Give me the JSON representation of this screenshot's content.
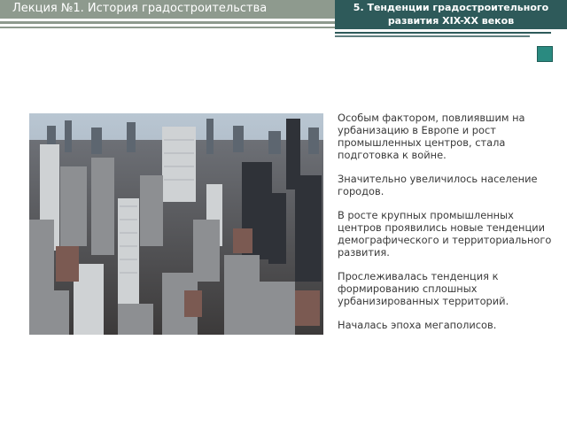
{
  "header": {
    "lecture_title": "Лекция №1. История градостроительства",
    "section_title_line1": "5. Тенденции градостроительного",
    "section_title_line2": "развития XIX-XX веков"
  },
  "photo": {
    "subject": "aerial city skyline"
  },
  "content": {
    "paragraphs": [
      "Особым фактором, повлиявшим на урбанизацию в Европе и рост промышленных центров, стала подготовка к войне.",
      "Значительно увеличилось население городов.",
      "В росте крупных промышленных центров проявились новые тенденции демографического и территориального развития.",
      "Прослеживалась тенденция к формированию сплошных урбанизированных территорий.",
      "Началась эпоха мегаполисов."
    ]
  },
  "colors": {
    "header_left_bg": "#8e9a8e",
    "header_right_bg": "#2e5a5a",
    "accent_square": "#2a8a80",
    "body_text": "#3a3a3a"
  }
}
